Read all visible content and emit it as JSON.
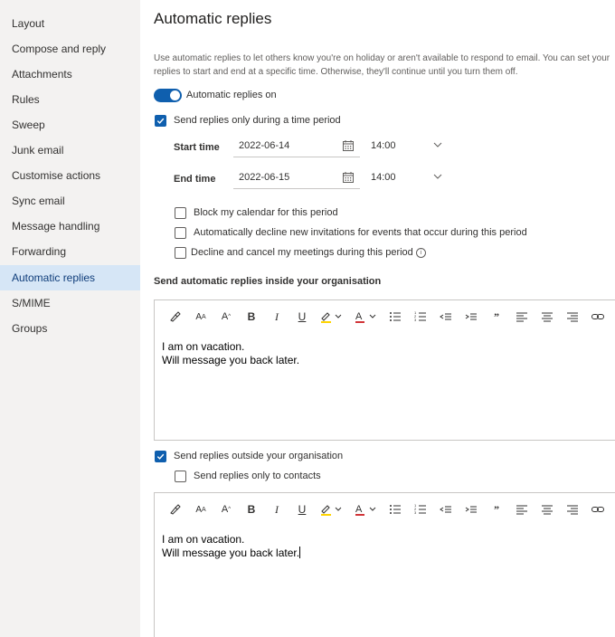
{
  "sidebar": {
    "items": [
      {
        "label": "Layout",
        "active": false
      },
      {
        "label": "Compose and reply",
        "active": false
      },
      {
        "label": "Attachments",
        "active": false
      },
      {
        "label": "Rules",
        "active": false
      },
      {
        "label": "Sweep",
        "active": false
      },
      {
        "label": "Junk email",
        "active": false
      },
      {
        "label": "Customise actions",
        "active": false
      },
      {
        "label": "Sync email",
        "active": false
      },
      {
        "label": "Message handling",
        "active": false
      },
      {
        "label": "Forwarding",
        "active": false
      },
      {
        "label": "Automatic replies",
        "active": true
      },
      {
        "label": "S/MIME",
        "active": false
      },
      {
        "label": "Groups",
        "active": false
      }
    ]
  },
  "main": {
    "title": "Automatic replies",
    "description": "Use automatic replies to let others know you're on holiday or aren't available to respond to email. You can set your replies to start and end at a specific time. Otherwise, they'll continue until you turn them off.",
    "toggle_label": "Automatic replies on",
    "toggle_on": true,
    "time_period_label": "Send replies only during a time period",
    "time_period_checked": true,
    "start": {
      "label": "Start time",
      "date": "2022-06-14",
      "time": "14:00"
    },
    "end": {
      "label": "End time",
      "date": "2022-06-15",
      "time": "14:00"
    },
    "options": [
      {
        "label": "Block my calendar for this period",
        "checked": false
      },
      {
        "label": "Automatically decline new invitations for events that occur during this period",
        "checked": false
      },
      {
        "label": "Decline and cancel my meetings during this period",
        "checked": false
      }
    ],
    "inside": {
      "heading": "Send automatic replies inside your organisation",
      "message_line1": "I am on vacation.",
      "message_line2": "Will message you back later."
    },
    "outside": {
      "label": "Send replies outside your organisation",
      "checked": true,
      "contacts_label": "Send replies only to contacts",
      "contacts_checked": false,
      "message_line1": "I am on vacation.",
      "message_line2": "Will message you back later."
    }
  },
  "colors": {
    "accent": "#0f5fae",
    "sidebar_bg": "#f3f2f1",
    "active_bg": "#d6e6f6"
  }
}
